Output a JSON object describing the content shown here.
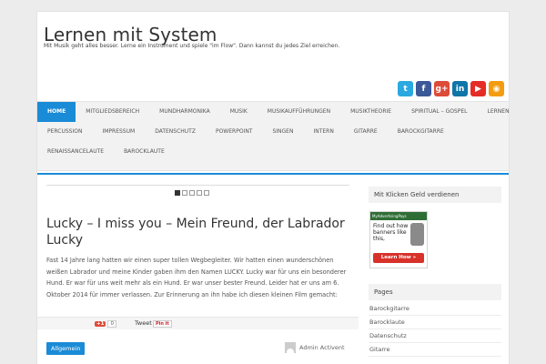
{
  "header": {
    "title": "Lernen mit System",
    "tagline": "Mit Musik geht alles besser. Lerne ein Instrument und spiele \"im Flow\". Dann kannst du jedes Ziel erreichen."
  },
  "social": [
    {
      "name": "twitter",
      "glyph": "t",
      "color": "#2aa9e0"
    },
    {
      "name": "facebook",
      "glyph": "f",
      "color": "#3b5998"
    },
    {
      "name": "googleplus",
      "glyph": "g+",
      "color": "#dd4b39"
    },
    {
      "name": "linkedin",
      "glyph": "in",
      "color": "#0e76a8"
    },
    {
      "name": "youtube",
      "glyph": "▶",
      "color": "#e52d27"
    },
    {
      "name": "rss",
      "glyph": "◉",
      "color": "#f39c12"
    }
  ],
  "nav": {
    "row1": [
      "Home",
      "Mitgliedsbereich",
      "Mundharmonika",
      "Musik",
      "Musikaufführungen",
      "Musiktheorie",
      "Spiritual – Gospel",
      "Lernen"
    ],
    "row2": [
      "Percussion",
      "Impressum",
      "Datenschutz",
      "Powerpoint",
      "Singen",
      "Intern",
      "Gitarre",
      "Barockgitarre"
    ],
    "row3": [
      "Renaissancelaute",
      "Barocklaute"
    ]
  },
  "post": {
    "title": "Lucky – I miss you – Mein Freund, der Labrador Lucky",
    "body": "Fast 14 Jahre lang hatten wir einen super tollen Wegbegleiter. Wir hatten einen wunderschönen weißen Labrador und meine Kinder gaben ihm den Namen LUCKY. Lucky war für uns ein besonderer Hund. Er war für uns weit mehr als ein Hund. Er war unser bester Freund. Leider hat er uns am 6. Oktober 2014 für immer verlassen. Zur Erinnerung an ihn habe ich diesen kleinen Film gemacht:",
    "gplus_label": "+1",
    "gplus_count": "0",
    "tweet_label": "Tweet",
    "pinit_label": "Pin it",
    "category": "Allgemein",
    "author": "Admin Activent"
  },
  "sidebar": {
    "widget1_title": "Mit Klicken Geld verdienen",
    "ad": {
      "brand": "MyAdvertisingPays",
      "text": "Find out how banners like this,",
      "button": "Learn How »"
    },
    "pages_title": "Pages",
    "pages": [
      "Barockgitarre",
      "Barocklaute",
      "Datenschutz",
      "Gitarre"
    ]
  }
}
